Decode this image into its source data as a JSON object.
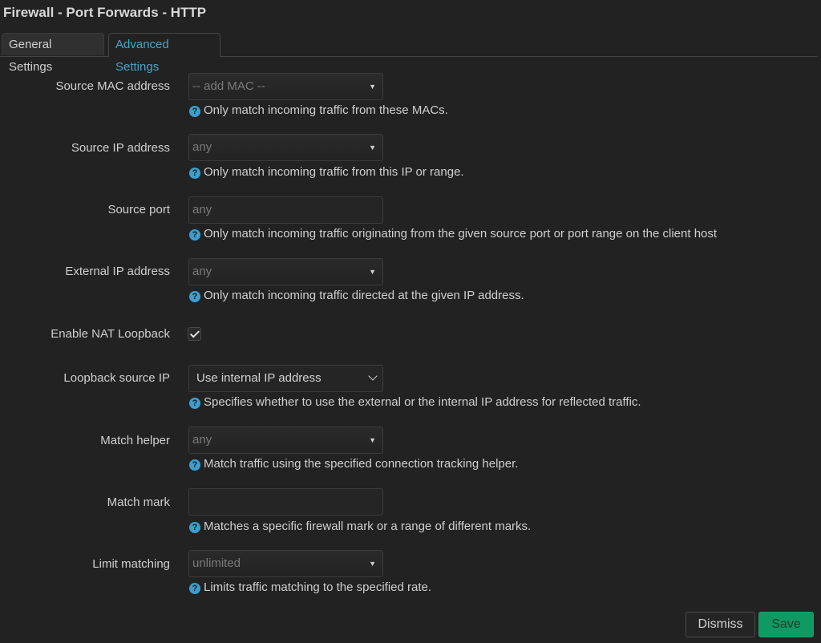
{
  "header": {
    "title": "Firewall - Port Forwards - HTTP"
  },
  "tabs": [
    {
      "label": "General Settings",
      "active": false
    },
    {
      "label": "Advanced Settings",
      "active": true
    }
  ],
  "fields": {
    "source_mac": {
      "label": "Source MAC address",
      "value": "-- add MAC --",
      "help": "Only match incoming traffic from these MACs."
    },
    "source_ip": {
      "label": "Source IP address",
      "value": "any",
      "help": "Only match incoming traffic from this IP or range."
    },
    "source_port": {
      "label": "Source port",
      "placeholder": "any",
      "help": "Only match incoming traffic originating from the given source port or port range on the client host"
    },
    "external_ip": {
      "label": "External IP address",
      "value": "any",
      "help": "Only match incoming traffic directed at the given IP address."
    },
    "nat_loopback": {
      "label": "Enable NAT Loopback",
      "checked": true
    },
    "loopback_source_ip": {
      "label": "Loopback source IP",
      "value": "Use internal IP address",
      "help": "Specifies whether to use the external or the internal IP address for reflected traffic."
    },
    "match_helper": {
      "label": "Match helper",
      "value": "any",
      "help": "Match traffic using the specified connection tracking helper."
    },
    "match_mark": {
      "label": "Match mark",
      "value": "",
      "help": "Matches a specific firewall mark or a range of different marks."
    },
    "limit_matching": {
      "label": "Limit matching",
      "value": "unlimited",
      "help": "Limits traffic matching to the specified rate."
    }
  },
  "help_icon": "question-circle-icon",
  "colors": {
    "accent": "#4aa3c8",
    "save": "#0f9a63",
    "help_icon": "#3a9fd0",
    "background": "#222222"
  },
  "buttons": {
    "dismiss": "Dismiss",
    "save": "Save"
  }
}
